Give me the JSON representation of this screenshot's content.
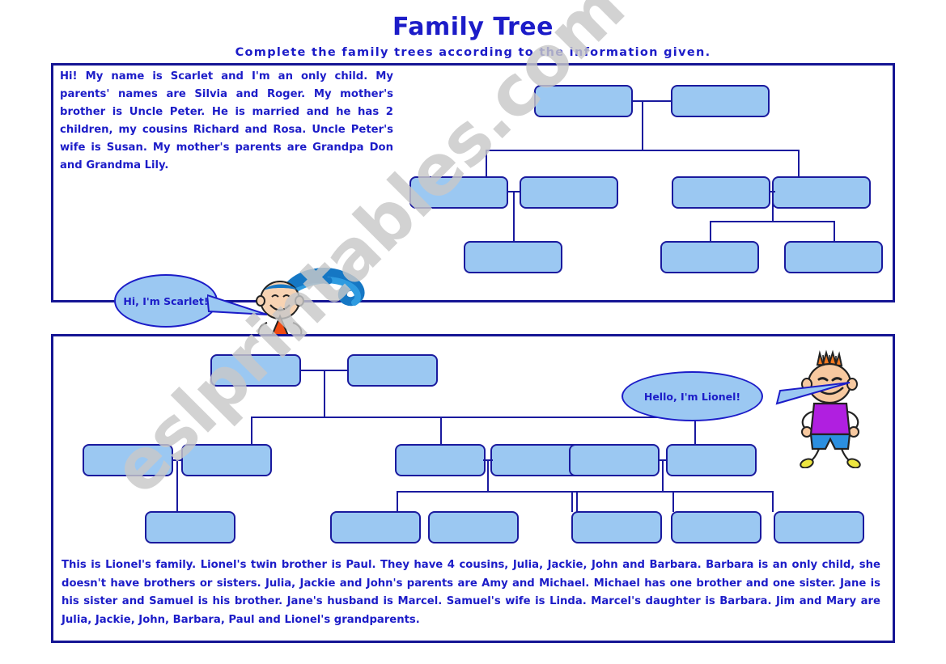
{
  "header": {
    "title": "Family Tree",
    "subtitle": "Complete the family trees according to the information given."
  },
  "watermark": {
    "text": "eslprintables.com",
    "color": "#c9c9c9"
  },
  "colors": {
    "ink": "#1c1cc8",
    "panel_border": "#151594",
    "box_fill": "#9BC8F2",
    "box_border": "#1a1a9e"
  },
  "exercise_one": {
    "story_lines": [
      "Hi! My name is Scarlet and I'm an only child.",
      "My parents' names are Silvia and Roger.",
      "My mother's brother is Uncle Peter. He is married and he has 2 children, my cousins Richard and Rosa. Uncle Peter's wife is Susan. My mother's parents are Grandpa Don and Grandma Lily."
    ],
    "story_full": "Hi! My name is Scarlet and I'm an only child. My parents' names are Silvia and Roger. My mother's brother is Uncle Peter. He is married and he has 2 children, my cousins Richard and Rosa. Uncle Peter's wife is Susan. My mother's parents are Grandpa Don and Grandma Lily.",
    "speech_bubble": "Hi, I'm Scarlet!",
    "character_name": "Scarlet",
    "tree": {
      "boxes_total": 9,
      "generations": 3,
      "rows": [
        {
          "label": "grandparents",
          "count": 2
        },
        {
          "label": "parents-and-aunt-uncle",
          "count": 4
        },
        {
          "label": "children",
          "count": 3
        }
      ]
    }
  },
  "exercise_two": {
    "story_full": "This is Lionel's family. Lionel's twin brother is Paul. They have 4 cousins, Julia, Jackie, John and Barbara. Barbara is an only child, she doesn't have brothers or sisters. Julia, Jackie and John's parents are Amy and Michael. Michael has one brother and one sister. Jane is his sister and Samuel is his brother. Jane's husband is Marcel. Samuel's wife is Linda. Marcel's daughter is Barbara. Jim and Mary are Julia, Jackie, John, Barbara, Paul and Lionel's grandparents.",
    "speech_bubble": "Hello, I'm Lionel!",
    "character_name": "Lionel",
    "tree": {
      "boxes_total": 13,
      "generations": 3,
      "rows": [
        {
          "label": "grandparents",
          "count": 2
        },
        {
          "label": "parents-aunts-uncles",
          "count": 6
        },
        {
          "label": "children",
          "count": 6
        }
      ]
    }
  }
}
